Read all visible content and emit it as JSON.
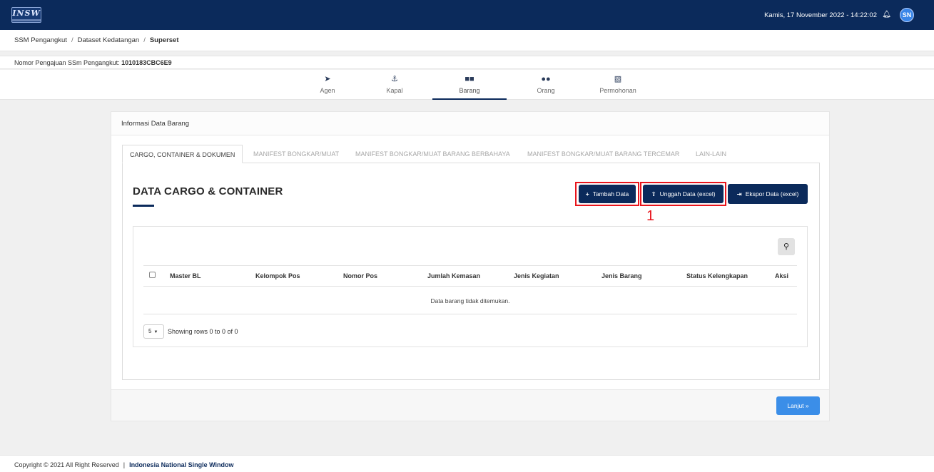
{
  "header": {
    "logo_text": "INSW",
    "datetime": "Kamis, 17 November 2022 - 14:22:02",
    "avatar_initials": "SN",
    "bell_icon": "bell-icon"
  },
  "breadcrumb": {
    "items": [
      "SSM Pengangkut",
      "Dataset Kedatangan",
      "Superset"
    ],
    "separator": "/"
  },
  "nomor": {
    "label": "Nomor Pengajuan SSm Pengangkut:",
    "value": "1010183CBC6E9"
  },
  "steps": [
    {
      "label": "Agen",
      "icon": "paper-plane-icon",
      "active": false
    },
    {
      "label": "Kapal",
      "icon": "ship-icon",
      "active": false
    },
    {
      "label": "Barang",
      "icon": "boxes-icon",
      "active": true
    },
    {
      "label": "Orang",
      "icon": "users-icon",
      "active": false
    },
    {
      "label": "Permohonan",
      "icon": "copy-icon",
      "active": false
    }
  ],
  "card": {
    "title": "Informasi Data Barang",
    "tabs": [
      "CARGO, CONTAINER & DOKUMEN",
      "MANIFEST BONGKAR/MUAT",
      "MANIFEST BONGKAR/MUAT BARANG BERBAHAYA",
      "MANIFEST BONGKAR/MUAT BARANG TERCEMAR",
      "LAIN-LAIN"
    ],
    "active_tab": 0,
    "section_title": "DATA CARGO & CONTAINER",
    "buttons": {
      "tambah": "Tambah Data",
      "unggah": "Unggah Data (excel)",
      "ekspor": "Ekspor Data (excel)"
    },
    "annotation": "1",
    "table": {
      "columns": [
        "Master BL",
        "Kelompok Pos",
        "Nomor Pos",
        "Jumlah Kemasan",
        "Jenis Kegiatan",
        "Jenis Barang",
        "Status Kelengkapan",
        "Aksi"
      ],
      "empty_text": "Data barang tidak ditemukan.",
      "page_size": "5",
      "pagination_text": "Showing rows 0 to 0 of 0"
    },
    "next_button": "Lanjut »"
  },
  "footer": {
    "copyright": "Copyright © 2021 All Right Reserved",
    "separator": "|",
    "brand": "Indonesia National Single Window"
  },
  "colors": {
    "navy": "#0b2a5b",
    "highlight_red": "#e8141c",
    "next_blue": "#3b8ee8"
  }
}
